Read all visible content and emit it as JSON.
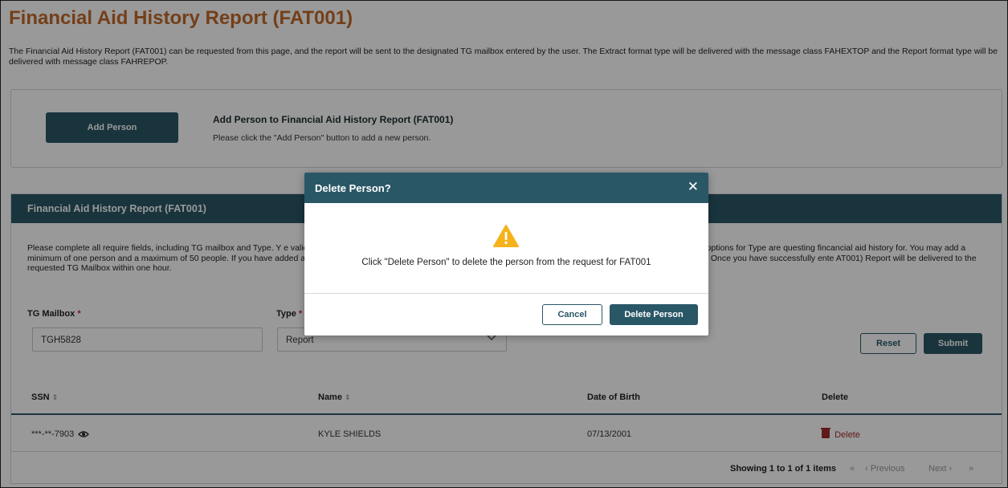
{
  "page": {
    "title": "Financial Aid History Report (FAT001)",
    "intro": "The Financial Aid History Report (FAT001) can be requested from this page, and the report will be sent to the designated TG mailbox entered by the user. The Extract format type will be delivered with the message class FAHEXTOP and the Report format type will be delivered with message class FAHREPOP."
  },
  "add_person": {
    "button_label": "Add Person",
    "heading": "Add Person to Financial Aid History Report (FAT001)",
    "description": "Please click the \"Add Person\" button to add a new person."
  },
  "report_section": {
    "title": "Financial Aid History Report (FAT001)",
    "instructions": "Please complete all require fields, including TG mailbox and Type. Y                                                                                                                                                                    e valid in the NSLDS system and associated to the school user's six-digit OPEID or to the ED user. The available options for Type are                                                                                                                               questing fincancial aid history for. You may add a minimum of one person and a maximum of 50 people. If you have added a person ar                                                                                                                         for that person, click the 'Delete' button next to their information to remove them from the request. Once you have successfully ente                                                                                                                     AT001) Report will be delivered to the requested TG Mailbox within one hour.",
    "tg_mailbox_label": "TG Mailbox",
    "tg_mailbox_value": "TGH5828",
    "type_label": "Type",
    "type_value": "Report",
    "required_mark": "*",
    "reset_label": "Reset",
    "submit_label": "Submit"
  },
  "table": {
    "columns": [
      "SSN",
      "Name",
      "Date of Birth",
      "Delete"
    ],
    "sort_glyph": "⇕",
    "rows": [
      {
        "ssn": "***-**-7903",
        "name": "KYLE SHIELDS",
        "dob": "07/13/2001",
        "delete": "Delete"
      }
    ],
    "pager": {
      "info": "Showing 1 to 1 of 1 items",
      "first": "«",
      "prev": "‹ Previous",
      "next": "Next ›",
      "last": "»"
    }
  },
  "modal": {
    "title": "Delete Person?",
    "close_glyph": "✕",
    "message": "Click \"Delete Person\" to delete the person from the request for FAT001",
    "cancel_label": "Cancel",
    "confirm_label": "Delete Person"
  },
  "colors": {
    "brand_teal": "#2a5766",
    "title_orange": "#c2692a",
    "warning_yellow": "#f5b21a",
    "delete_red": "#9e2a2a"
  },
  "icons": [
    "eye-icon",
    "trash-icon",
    "warning-icon",
    "close-icon",
    "chevron-down-icon",
    "sort-icon"
  ]
}
